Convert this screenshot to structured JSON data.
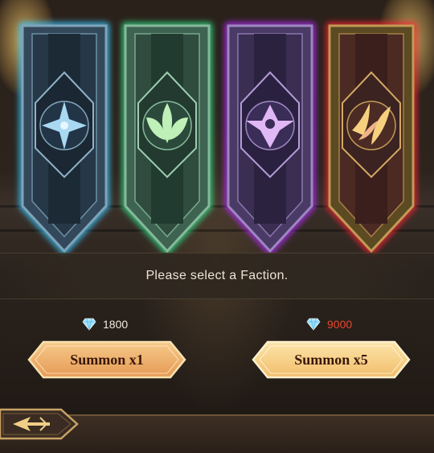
{
  "factions": [
    {
      "id": "lightbearers",
      "icon": "lightbearer-faction-icon",
      "glow": "#39c6ff",
      "body": "#3b5468",
      "accent": "#a9d9f2"
    },
    {
      "id": "wilders",
      "icon": "wilder-faction-icon",
      "glow": "#32e08a",
      "body": "#3f6a55",
      "accent": "#bff0b8"
    },
    {
      "id": "graveborn",
      "icon": "graveborn-faction-icon",
      "glow": "#b52cff",
      "body": "#4c3c6a",
      "accent": "#e0b8f5"
    },
    {
      "id": "maulers",
      "icon": "mauler-faction-icon",
      "glow": "#ff2233",
      "body": "#6a5a26",
      "accent": "#f6d07e"
    }
  ],
  "message": "Please select a Faction.",
  "summon_single": {
    "label": "Summon x1",
    "cost": "1800",
    "currency_icon": "diamond-icon"
  },
  "summon_multi": {
    "label": "Summon x5",
    "cost": "9000",
    "currency_icon": "diamond-icon",
    "cost_color": "#e8452c"
  },
  "colors": {
    "button_fill": "#f2b772",
    "button_border": "#f7e2b0",
    "text_light": "#ece4d6"
  }
}
